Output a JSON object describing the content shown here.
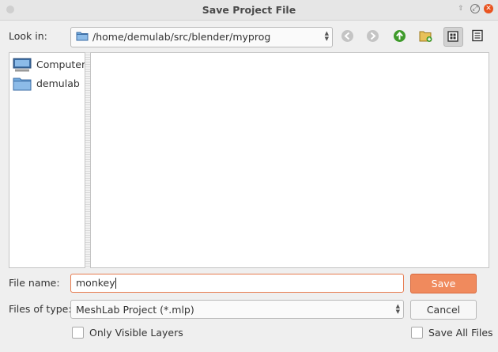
{
  "window": {
    "title": "Save Project File",
    "accent": "#e95420"
  },
  "toolbar": {
    "look_in_label": "Look in:",
    "path": "/home/demulab/src/blender/myprog",
    "buttons": [
      "back-icon",
      "forward-icon",
      "parent-folder-icon",
      "new-folder-icon",
      "icon-view-icon",
      "detail-view-icon"
    ]
  },
  "sidebar": {
    "items": [
      {
        "label": "Computer",
        "icon": "computer-icon"
      },
      {
        "label": "demulab",
        "icon": "folder-icon"
      }
    ]
  },
  "form": {
    "filename_label": "File name:",
    "filename_value": "monkey",
    "filetype_label": "Files of type:",
    "filetype_value": "MeshLab Project (*.mlp)",
    "save_label": "Save",
    "cancel_label": "Cancel",
    "only_visible_label": "Only Visible Layers",
    "save_all_label": "Save All Files"
  }
}
